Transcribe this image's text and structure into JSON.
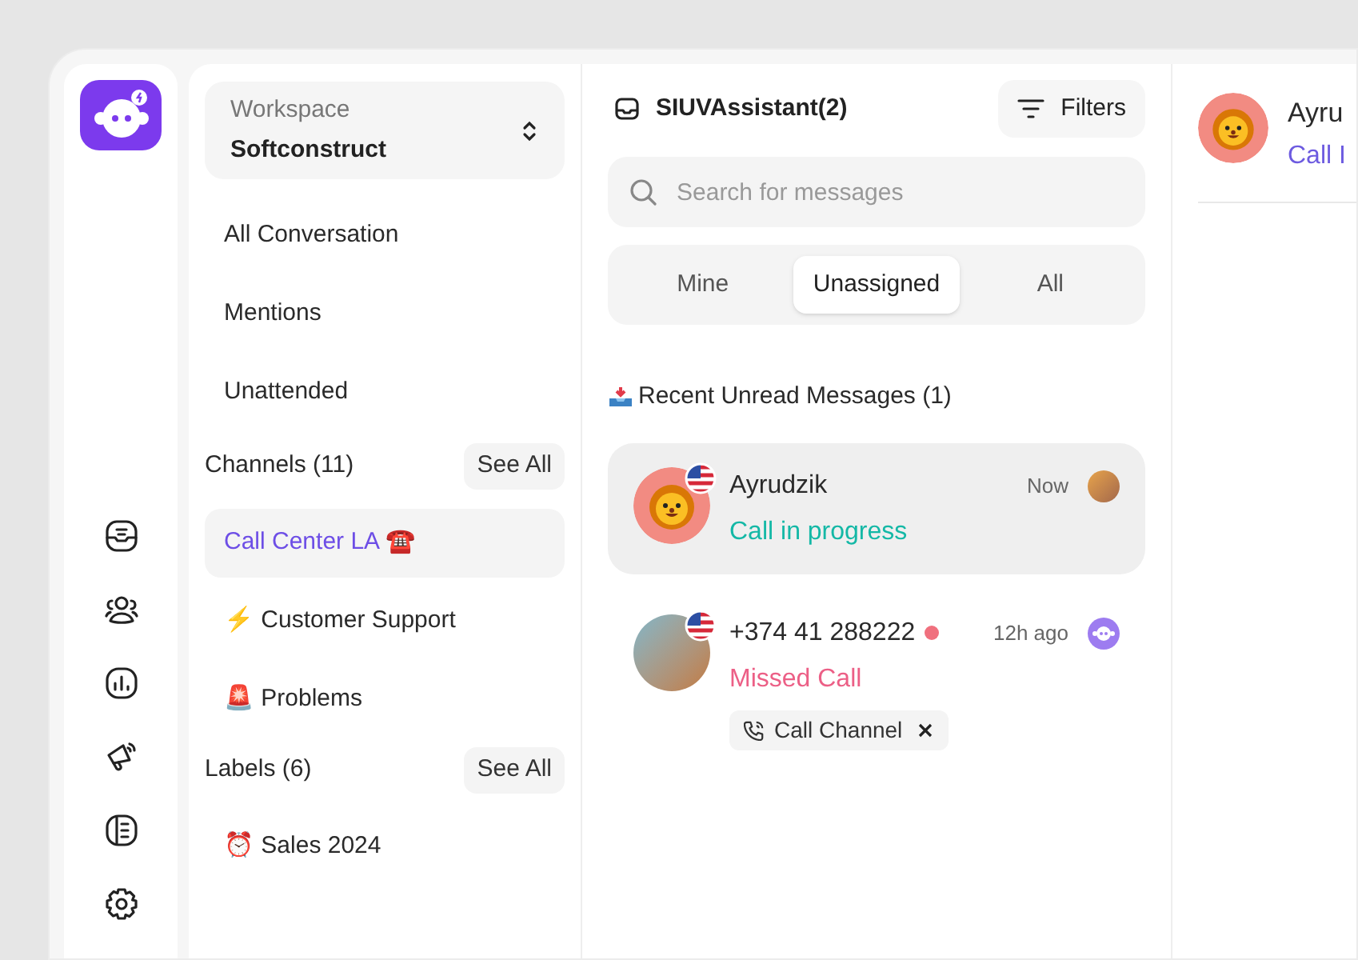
{
  "workspace": {
    "label": "Workspace",
    "value": "Softconstruct"
  },
  "nav": [
    {
      "label": "All Conversation",
      "selected": false
    },
    {
      "label": "Mentions",
      "selected": false
    },
    {
      "label": "Unattended",
      "selected": false
    }
  ],
  "channels": {
    "title": "Channels (11)",
    "see_all": "See All",
    "items": [
      {
        "label": "Call Center LA ☎️",
        "selected": true
      },
      {
        "label": "⚡ Customer Support",
        "selected": false
      },
      {
        "label": "🚨 Problems",
        "selected": false
      }
    ]
  },
  "labels": {
    "title": "Labels (6)",
    "see_all": "See All",
    "items": [
      {
        "label": "⏰ Sales 2024",
        "selected": false
      }
    ]
  },
  "inbox": {
    "title": "SIUVAssistant(2)",
    "filters": "Filters",
    "search_placeholder": "Search for messages",
    "tabs": [
      {
        "label": "Mine",
        "selected": false
      },
      {
        "label": "Unassigned",
        "selected": true
      },
      {
        "label": "All",
        "selected": false
      }
    ],
    "section": "Recent Unread Messages (1)",
    "conversations": [
      {
        "name": "Ayrudzik",
        "status": "Call in progress",
        "color": "#14b8a6",
        "time": "Now",
        "selected": true,
        "unread": false,
        "kind": "lion"
      },
      {
        "name": "+374 41 288222",
        "status": "Missed Call",
        "color": "#ec5f86",
        "time": "12h ago",
        "selected": false,
        "unread": true,
        "kind": "photo",
        "tag": "Call Channel"
      }
    ]
  },
  "detail": {
    "name": "Ayru",
    "status": "Call I"
  }
}
